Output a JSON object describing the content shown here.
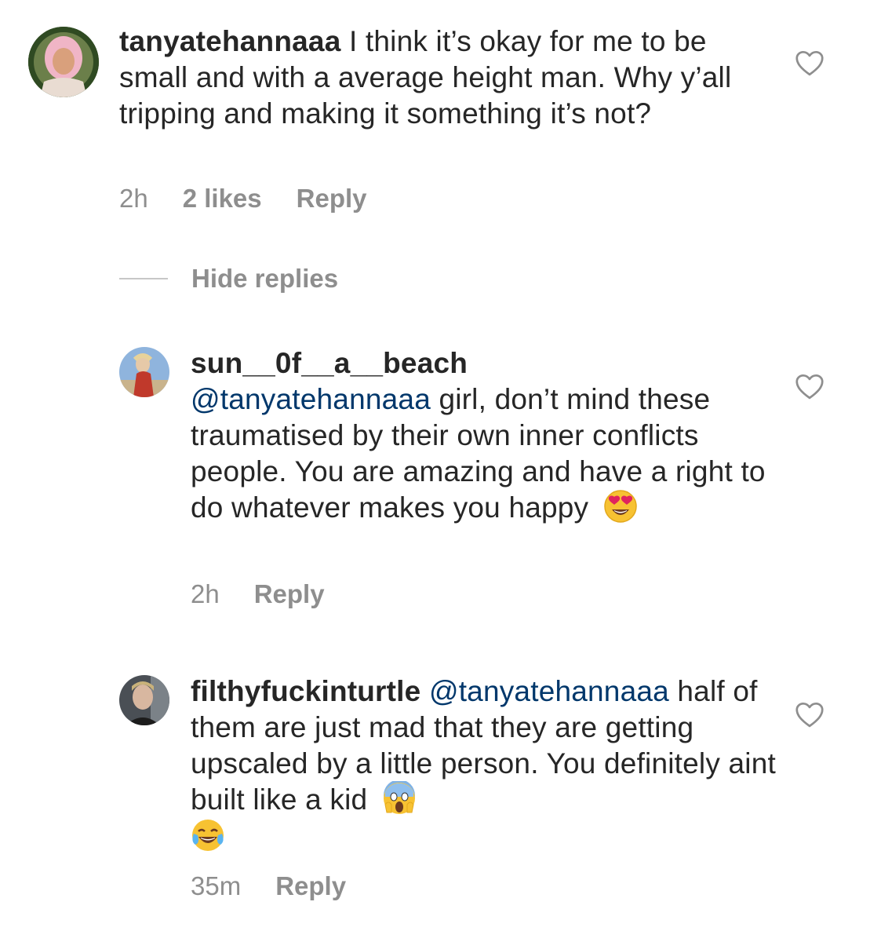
{
  "comments": [
    {
      "username": "tanyatehannaaa",
      "mention": "",
      "text": " I think it’s okay for me to be small and with a average height man. Why y’all tripping and making it something it’s not?",
      "time": "2h",
      "likes": "2 likes",
      "reply_label": "Reply"
    },
    {
      "username": "sun__0f__a__beach",
      "mention": "@tanyatehannaaa",
      "text": " girl, don’t mind these traumatised by their own inner conflicts people. You are amazing and have a right to do whatever makes you happy",
      "emoji": "heart-eyes",
      "time": "2h",
      "reply_label": "Reply"
    },
    {
      "username": "filthyfuckinturtle",
      "mention": "@tanyatehannaaa",
      "text": " half of them are just mad that they are getting upscaled by a little person. You definitely aint built like a kid",
      "emoji": "screaming-face",
      "emoji2": "tears-of-joy",
      "time": "35m",
      "reply_label": "Reply"
    }
  ],
  "hide_replies": "Hide replies",
  "colors": {
    "text": "#262626",
    "meta": "#8e8e8e",
    "mention": "#00376b"
  },
  "icons": [
    "heart-outline-icon",
    "avatar"
  ]
}
